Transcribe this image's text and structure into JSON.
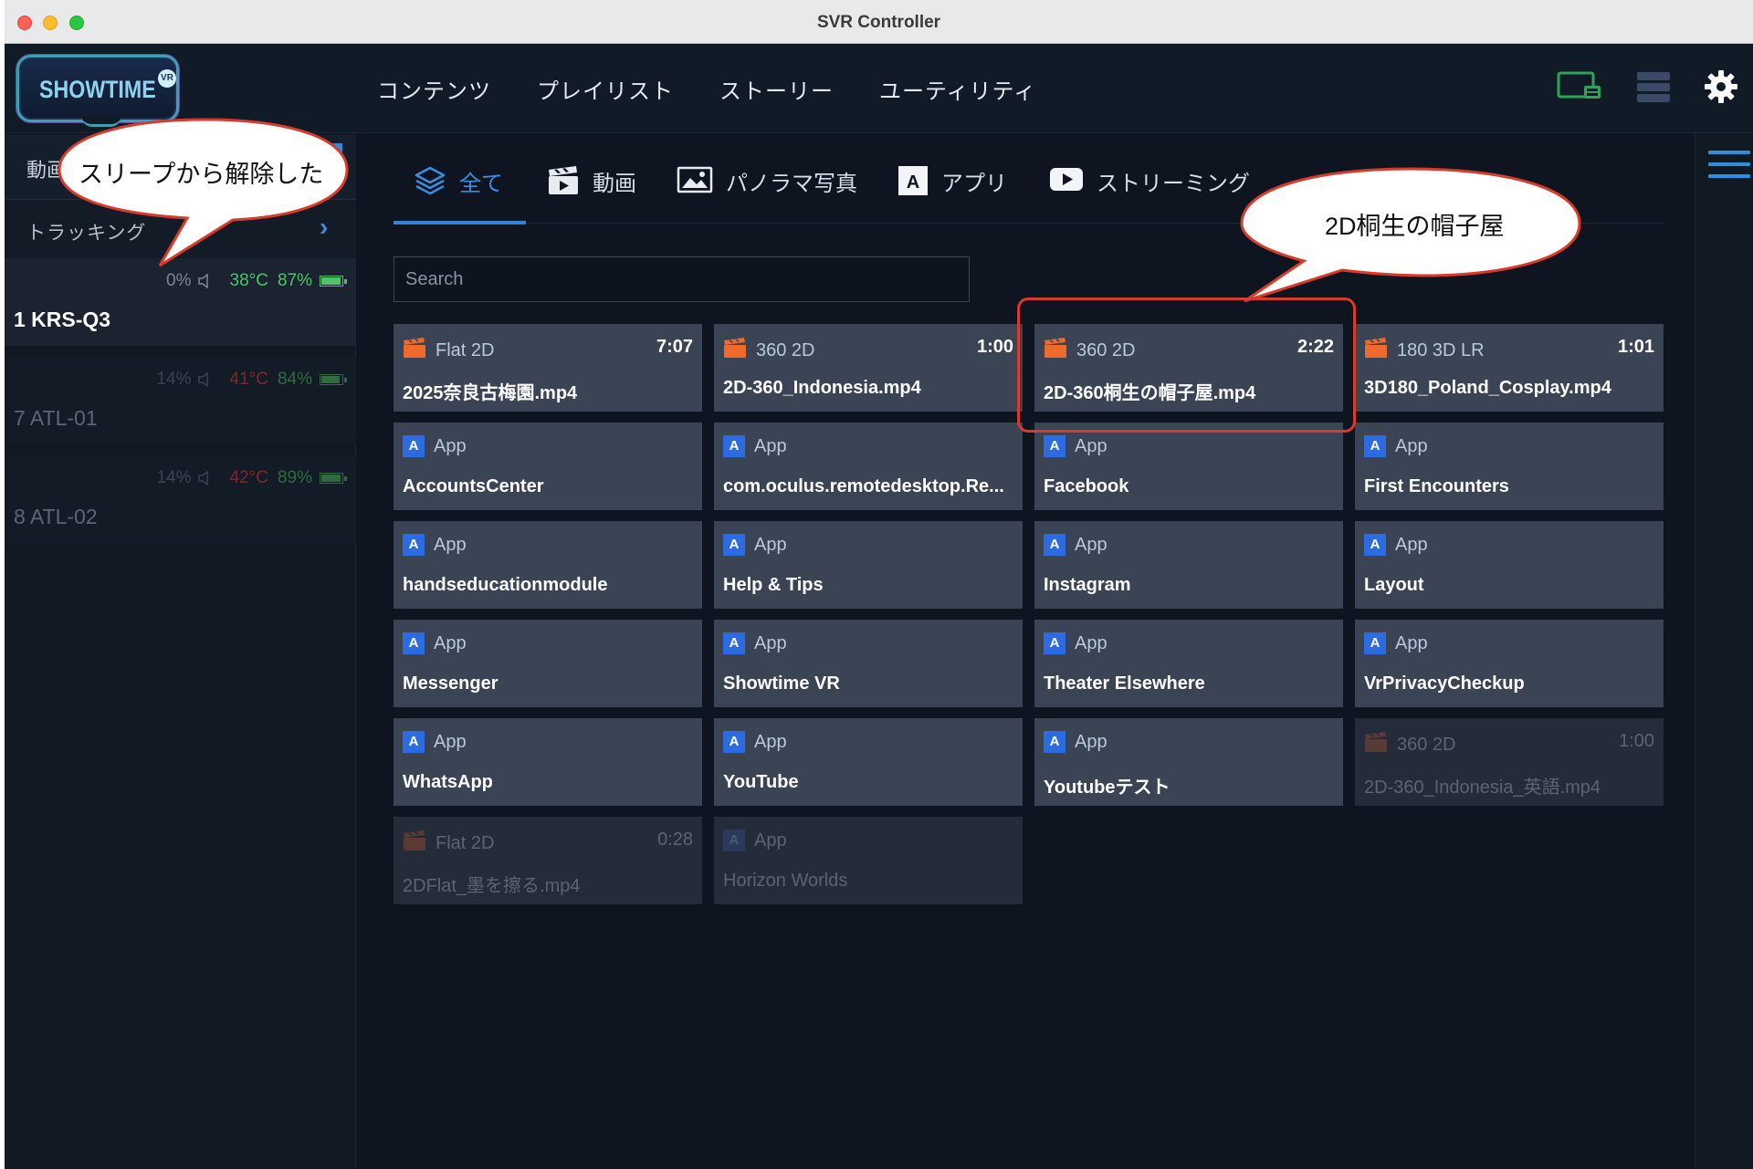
{
  "window": {
    "title": "SVR Controller"
  },
  "header": {
    "logo_text": "SHOWTIME",
    "logo_badge": "VR",
    "nav": [
      "コンテンツ",
      "プレイリスト",
      "ストーリー",
      "ユーティリティ"
    ]
  },
  "sidebar": {
    "row1_label": "動画",
    "row2_label": "トラッキング",
    "devices": [
      {
        "name": "1 KRS-Q3",
        "volume": "0%",
        "temp": "38°C",
        "battery": "87%",
        "temp_color": "#4fc36b",
        "batt_color": "#4fc36b",
        "battery_level": 0.87
      },
      {
        "name": "7 ATL-01",
        "volume": "14%",
        "temp": "41°C",
        "battery": "84%",
        "temp_color": "#7a2a2e",
        "batt_color": "#2f6b3e",
        "battery_level": 0.84
      },
      {
        "name": "8 ATL-02",
        "volume": "14%",
        "temp": "42°C",
        "battery": "89%",
        "temp_color": "#7a2a2e",
        "batt_color": "#2f6b3e",
        "battery_level": 0.89
      }
    ]
  },
  "tabs": [
    {
      "label": "全て",
      "icon": "layers-icon",
      "active": true
    },
    {
      "label": "動画",
      "icon": "clapperboard-icon"
    },
    {
      "label": "パノラマ写真",
      "icon": "image-icon"
    },
    {
      "label": "アプリ",
      "icon": "app-icon"
    },
    {
      "label": "ストリーミング",
      "icon": "play-icon"
    }
  ],
  "search": {
    "placeholder": "Search",
    "value": ""
  },
  "tiles": [
    {
      "kind": "video",
      "type": "Flat 2D",
      "duration": "7:07",
      "name": "2025奈良古梅園.mp4"
    },
    {
      "kind": "video",
      "type": "360 2D",
      "duration": "1:00",
      "name": "2D-360_Indonesia.mp4"
    },
    {
      "kind": "video",
      "type": "360 2D",
      "duration": "2:22",
      "name": "2D-360桐生の帽子屋.mp4"
    },
    {
      "kind": "video",
      "type": "180 3D LR",
      "duration": "1:01",
      "name": "3D180_Poland_Cosplay.mp4"
    },
    {
      "kind": "app",
      "type": "App",
      "name": "AccountsCenter"
    },
    {
      "kind": "app",
      "type": "App",
      "name": "com.oculus.remotedesktop.Re..."
    },
    {
      "kind": "app",
      "type": "App",
      "name": "Facebook"
    },
    {
      "kind": "app",
      "type": "App",
      "name": "First Encounters"
    },
    {
      "kind": "app",
      "type": "App",
      "name": "handseducationmodule"
    },
    {
      "kind": "app",
      "type": "App",
      "name": "Help & Tips"
    },
    {
      "kind": "app",
      "type": "App",
      "name": "Instagram"
    },
    {
      "kind": "app",
      "type": "App",
      "name": "Layout"
    },
    {
      "kind": "app",
      "type": "App",
      "name": "Messenger"
    },
    {
      "kind": "app",
      "type": "App",
      "name": "Showtime VR"
    },
    {
      "kind": "app",
      "type": "App",
      "name": "Theater Elsewhere"
    },
    {
      "kind": "app",
      "type": "App",
      "name": "VrPrivacyCheckup"
    },
    {
      "kind": "app",
      "type": "App",
      "name": "WhatsApp"
    },
    {
      "kind": "app",
      "type": "App",
      "name": "YouTube"
    },
    {
      "kind": "app",
      "type": "App",
      "name": "Youtubeテスト"
    },
    {
      "kind": "video",
      "type": "360 2D",
      "duration": "1:00",
      "name": "2D-360_Indonesia_英語.mp4",
      "disabled": true
    },
    {
      "kind": "video",
      "type": "Flat 2D",
      "duration": "0:28",
      "name": "2DFlat_墨を擦る.mp4",
      "disabled": true
    },
    {
      "kind": "app",
      "type": "App",
      "name": "Horizon Worlds",
      "disabled": true
    }
  ],
  "annotations": {
    "left_bubble": "スリープから解除した",
    "right_bubble": "2D桐生の帽子屋"
  },
  "colors": {
    "accent": "#2e86d8",
    "tile_bg": "#3b4455",
    "video_icon": "#f06a2c",
    "highlight": "#d83a2c"
  }
}
